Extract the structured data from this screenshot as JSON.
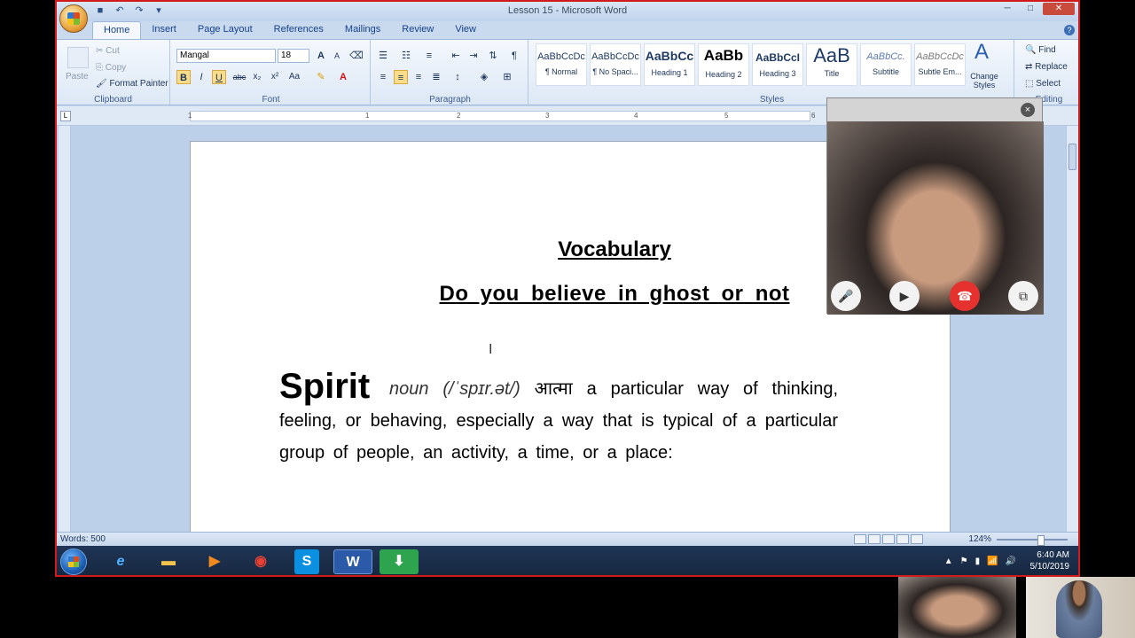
{
  "window": {
    "title": "Lesson 15 - Microsoft Word",
    "controls": [
      "─",
      "□",
      "✕"
    ]
  },
  "tabs": [
    "Home",
    "Insert",
    "Page Layout",
    "References",
    "Mailings",
    "Review",
    "View"
  ],
  "ribbon": {
    "clipboard": {
      "label": "Clipboard",
      "paste": "Paste",
      "cut": "Cut",
      "copy": "Copy",
      "format_painter": "Format Painter"
    },
    "font": {
      "label": "Font",
      "font_name": "Mangal",
      "font_size": "18",
      "bold": "B",
      "italic": "I",
      "underline": "U",
      "strike": "abc",
      "subscript": "x₂",
      "superscript": "x²",
      "case": "Aa",
      "grow": "A",
      "shrink": "A"
    },
    "paragraph": {
      "label": "Paragraph"
    },
    "styles": {
      "label": "Styles",
      "items": [
        {
          "preview": "AaBbCcDc",
          "name": "¶ Normal"
        },
        {
          "preview": "AaBbCcDc",
          "name": "¶ No Spaci..."
        },
        {
          "preview": "AaBbCc",
          "name": "Heading 1"
        },
        {
          "preview": "AaBb",
          "name": "Heading 2"
        },
        {
          "preview": "AaBbCcI",
          "name": "Heading 3"
        },
        {
          "preview": "AaB",
          "name": "Title"
        },
        {
          "preview": "AaBbCc.",
          "name": "Subtitle"
        },
        {
          "preview": "AaBbCcDc",
          "name": "Subtle Em..."
        }
      ],
      "change_styles": "Change Styles"
    },
    "editing": {
      "label": "Editing",
      "find": "Find",
      "replace": "Replace",
      "select": "Select"
    }
  },
  "ruler": {
    "numbers": [
      "1",
      "1",
      "2",
      "3",
      "4",
      "5",
      "6"
    ]
  },
  "document": {
    "title": "Vocabulary",
    "subtitle": "Do you believe in ghost or not",
    "entry_word": "Spirit",
    "entry_pos": "noun (/ˈspɪr.ət/)",
    "entry_hindi": "आत्मा",
    "entry_definition": "a particular way of thinking, feeling, or behaving, especially a way that is typical of a particular group of people, an activity, a time, or a place:"
  },
  "status": {
    "words": "Words: 500",
    "zoom": "124%"
  },
  "taskbar": {
    "time": "6:40 AM",
    "date": "5/10/2019"
  }
}
